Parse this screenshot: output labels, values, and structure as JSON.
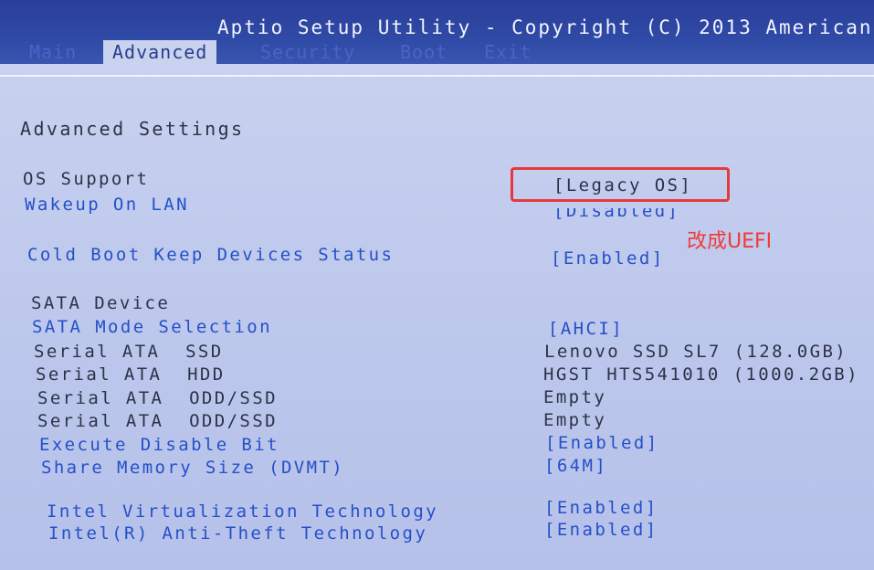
{
  "title": "Aptio Setup Utility - Copyright (C) 2013 American",
  "tabs": [
    {
      "label": "Main"
    },
    {
      "label": "Advanced"
    },
    {
      "label": "Security"
    },
    {
      "label": "Boot"
    },
    {
      "label": "Exit"
    }
  ],
  "page_heading": "Advanced Settings",
  "settings": {
    "os_support": {
      "label": "OS Support",
      "value": "[Legacy OS]"
    },
    "wakeup_on_lan": {
      "label": "Wakeup On LAN",
      "value": "[Disabled]"
    },
    "cold_boot": {
      "label": "Cold Boot Keep Devices Status",
      "value": "[Enabled]"
    },
    "sata_device_heading": "SATA Device",
    "sata_mode": {
      "label": "SATA Mode Selection",
      "value": "[AHCI]"
    },
    "serial_ata_ssd": {
      "label": "Serial ATA  SSD",
      "value": "Lenovo SSD SL7 (128.0GB)"
    },
    "serial_ata_hdd": {
      "label": "Serial ATA  HDD",
      "value": "HGST HTS541010 (1000.2GB)"
    },
    "serial_ata_odd1": {
      "label": "Serial ATA  ODD/SSD",
      "value": "Empty"
    },
    "serial_ata_odd2": {
      "label": "Serial ATA  ODD/SSD",
      "value": "Empty"
    },
    "execute_disable": {
      "label": "Execute Disable Bit",
      "value": "[Enabled]"
    },
    "share_memory": {
      "label": "Share Memory Size (DVMT)",
      "value": "[64M]"
    },
    "intel_vt": {
      "label": "Intel Virtualization Technology",
      "value": "[Enabled]"
    },
    "intel_anti_theft": {
      "label": "Intel(R) Anti-Theft Technology",
      "value": "[Enabled]"
    }
  },
  "annotation": {
    "text": "改成UEFI",
    "color": "#f03a3a"
  },
  "colors": {
    "header_bg": "#2f4aa6",
    "panel_bg": "#c8d1ef",
    "option_text": "#2450c8",
    "static_text": "#2d3248",
    "highlight_box": "#e63a3a"
  }
}
